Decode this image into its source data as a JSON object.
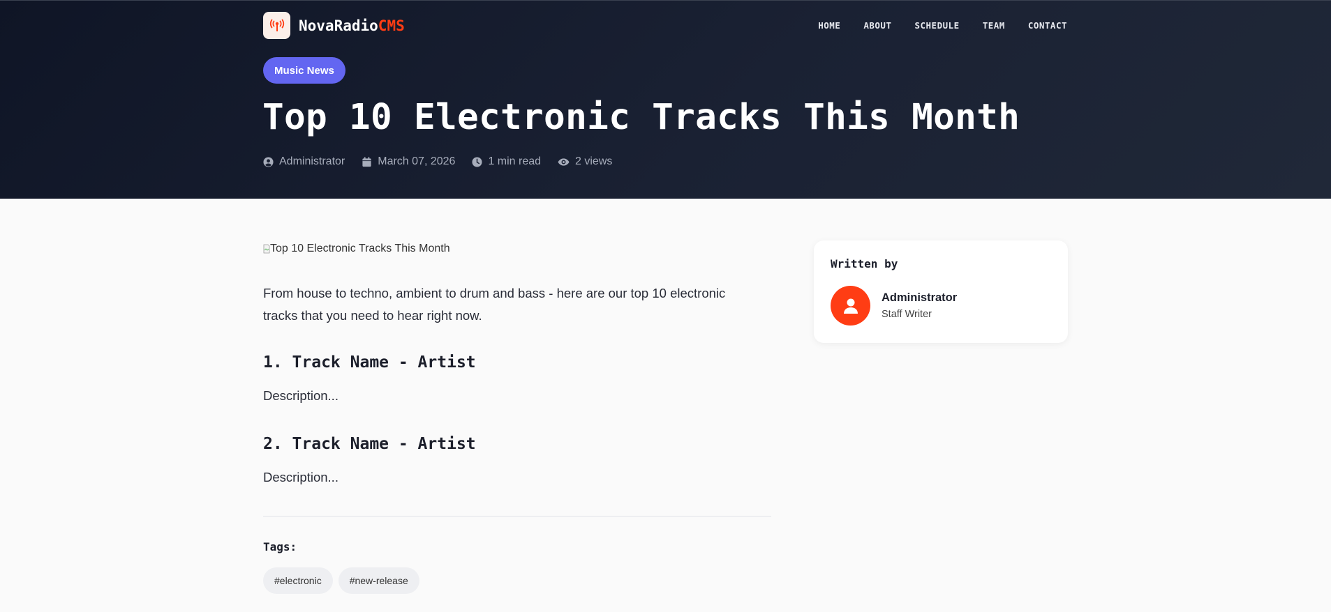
{
  "brand": {
    "name_main": "NovaRadio",
    "name_accent": "CMS",
    "logo_icon": "radio-tower-icon",
    "accent_color": "#ff3d14"
  },
  "nav": {
    "items": [
      "HOME",
      "ABOUT",
      "SCHEDULE",
      "TEAM",
      "CONTACT"
    ]
  },
  "post": {
    "category": "Music News",
    "category_color": "#6366f1",
    "title": "Top 10 Electronic Tracks This Month",
    "meta": {
      "author": "Administrator",
      "date": "March 07, 2026",
      "read_time": "1 min read",
      "views": "2 views"
    },
    "image_alt": "Top 10 Electronic Tracks This Month",
    "lead": "From house to techno, ambient to drum and bass - here are our top 10 electronic tracks that you need to hear right now.",
    "tracks": [
      {
        "heading": "1. Track Name - Artist",
        "description": "Description..."
      },
      {
        "heading": "2. Track Name - Artist",
        "description": "Description..."
      }
    ],
    "tags_label": "Tags:",
    "tags": [
      "#electronic",
      "#new-release"
    ]
  },
  "author_card": {
    "heading": "Written by",
    "name": "Administrator",
    "role": "Staff Writer",
    "avatar_icon": "user-icon"
  }
}
